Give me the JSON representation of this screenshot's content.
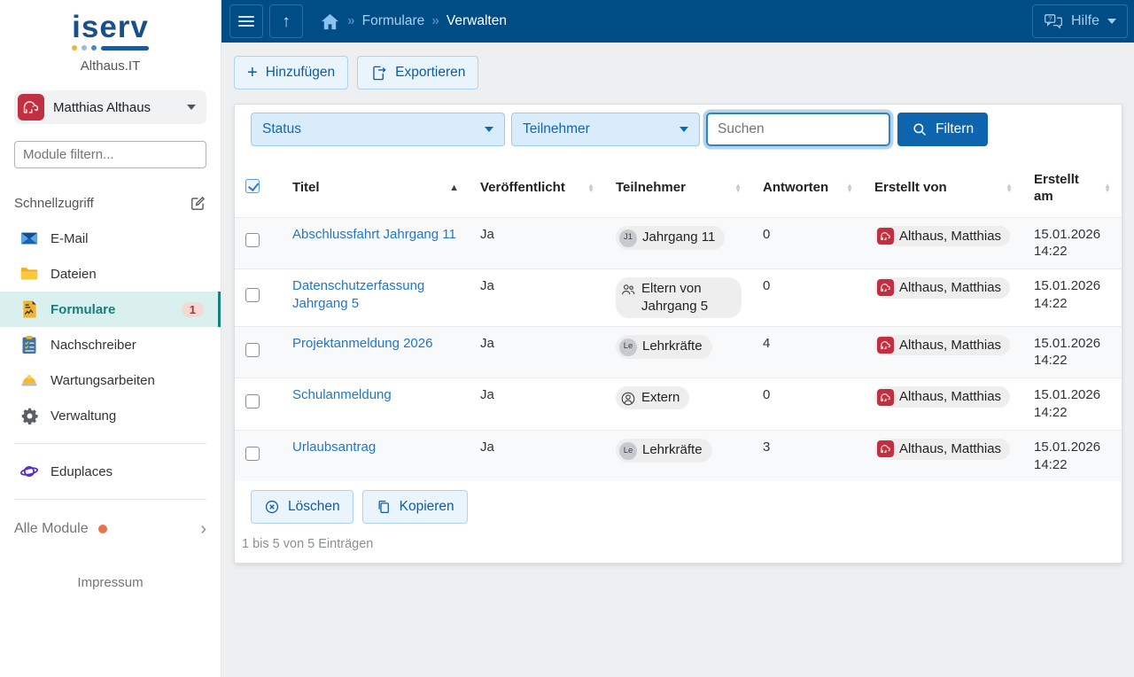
{
  "brand": {
    "logo": "iserv",
    "site": "Althaus.IT"
  },
  "user": {
    "name": "Matthias Althaus"
  },
  "sidebar": {
    "filter_placeholder": "Module filtern...",
    "quick_access_label": "Schnellzugriff",
    "items": [
      {
        "label": "E-Mail",
        "icon": "envelope-icon"
      },
      {
        "label": "Dateien",
        "icon": "folder-icon"
      },
      {
        "label": "Formulare",
        "icon": "form-document-icon",
        "badge": "1",
        "active": true
      },
      {
        "label": "Nachschreiber",
        "icon": "clipboard-icon"
      },
      {
        "label": "Wartungsarbeiten",
        "icon": "hard-hat-icon"
      },
      {
        "label": "Verwaltung",
        "icon": "gear-icon"
      }
    ],
    "eduplaces_label": "Eduplaces",
    "all_modules_label": "Alle Module",
    "impressum_label": "Impressum"
  },
  "navbar": {
    "separator": "»",
    "breadcrumb": [
      {
        "label": "Formulare"
      },
      {
        "label": "Verwalten"
      }
    ],
    "help_label": "Hilfe"
  },
  "toolbar": {
    "add_label": "Hinzufügen",
    "export_label": "Exportieren"
  },
  "filters": {
    "status_label": "Status",
    "participants_label": "Teilnehmer",
    "search_placeholder": "Suchen",
    "filter_button_label": "Filtern"
  },
  "table": {
    "headers": [
      "Titel",
      "Veröffentlicht",
      "Teilnehmer",
      "Antworten",
      "Erstellt von",
      "Erstellt am"
    ],
    "select_all_checked": true,
    "rows": [
      {
        "title": "Abschlussfahrt Jahrgang 11",
        "published": "Ja",
        "participants": "Jahrgang 11",
        "participants_icon": "initials-badge",
        "participants_initials": "J1",
        "answers": "0",
        "created_by": "Althaus, Matthias",
        "created_at": "15.01.2026 14:22"
      },
      {
        "title": "Datenschutzerfassung Jahrgang 5",
        "published": "Ja",
        "participants": "Eltern von Jahrgang 5",
        "participants_icon": "people-icon",
        "participants_initials": "",
        "answers": "0",
        "created_by": "Althaus, Matthias",
        "created_at": "15.01.2026 14:22"
      },
      {
        "title": "Projektanmeldung 2026",
        "published": "Ja",
        "participants": "Lehrkräfte",
        "participants_icon": "initials-badge",
        "participants_initials": "Le",
        "answers": "4",
        "created_by": "Althaus, Matthias",
        "created_at": "15.01.2026 14:22"
      },
      {
        "title": "Schulanmeldung",
        "published": "Ja",
        "participants": "Extern",
        "participants_icon": "person-circle-icon",
        "participants_initials": "",
        "answers": "0",
        "created_by": "Althaus, Matthias",
        "created_at": "15.01.2026 14:22"
      },
      {
        "title": "Urlaubsantrag",
        "published": "Ja",
        "participants": "Lehrkräfte",
        "participants_icon": "initials-badge",
        "participants_initials": "Le",
        "answers": "3",
        "created_by": "Althaus, Matthias",
        "created_at": "15.01.2026 14:22"
      }
    ]
  },
  "actions": {
    "delete_label": "Löschen",
    "copy_label": "Kopieren"
  },
  "footer": {
    "entries_info": "1 bis 5 von 5 Einträgen"
  },
  "icons": {
    "sort_asc": "▲",
    "sort_desc": "▼",
    "chevron_right": "›",
    "up_arrow": "↑",
    "plus": "+"
  },
  "colors": {
    "navbar_blue": "#004d85",
    "primary_blue": "#0f65ad",
    "active_teal": "#17807d",
    "active_teal_bg": "#d9f0ef",
    "avatar_red": "#c22f40",
    "badge_bg": "#f6d8d2",
    "badge_text": "#9c3a28",
    "link_blue": "#2277c4",
    "select_bg": "#d9ecfb",
    "alert_orange": "#e8744f"
  }
}
